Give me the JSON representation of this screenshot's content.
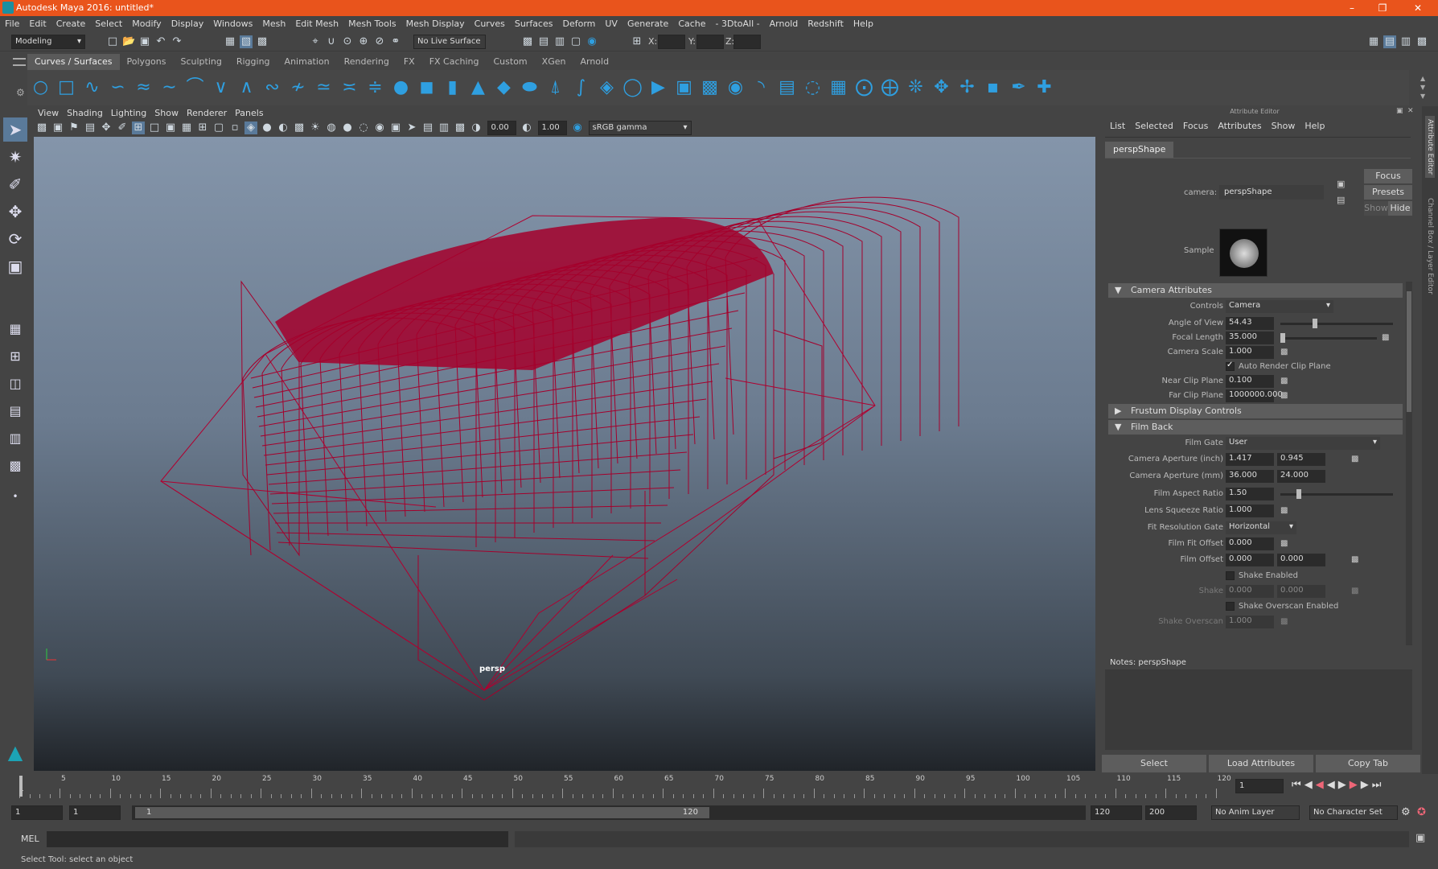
{
  "title": "Autodesk Maya 2016: untitled*",
  "menu": [
    "File",
    "Edit",
    "Create",
    "Select",
    "Modify",
    "Display",
    "Windows",
    "Mesh",
    "Edit Mesh",
    "Mesh Tools",
    "Mesh Display",
    "Curves",
    "Surfaces",
    "Deform",
    "UV",
    "Generate",
    "Cache",
    "- 3DtoAll -",
    "Arnold",
    "Redshift",
    "Help"
  ],
  "status": {
    "mode": "Modeling",
    "live": "No Live Surface",
    "x_label": "X:",
    "y_label": "Y:",
    "z_label": "Z:"
  },
  "shelf_tabs": [
    "Curves / Surfaces",
    "Polygons",
    "Sculpting",
    "Rigging",
    "Animation",
    "Rendering",
    "FX",
    "FX Caching",
    "Custom",
    "XGen",
    "Arnold"
  ],
  "viewport": {
    "menu": [
      "View",
      "Shading",
      "Lighting",
      "Show",
      "Renderer",
      "Panels"
    ],
    "exposure": "0.00",
    "gamma": "1.00",
    "colorspace": "sRGB gamma",
    "camera_label": "persp"
  },
  "attr": {
    "panel_title": "Attribute Editor",
    "menu": [
      "List",
      "Selected",
      "Focus",
      "Attributes",
      "Show",
      "Help"
    ],
    "tab": "perspShape",
    "camera_label": "camera:",
    "camera_value": "perspShape",
    "focus": "Focus",
    "presets": "Presets",
    "show": "Show",
    "hide": "Hide",
    "sample": "Sample",
    "sections": {
      "camera": "Camera Attributes",
      "frustum": "Frustum Display Controls",
      "filmback": "Film Back"
    },
    "controls_label": "Controls",
    "controls_value": "Camera",
    "angle_label": "Angle of View",
    "angle": "54.43",
    "focal_label": "Focal Length",
    "focal": "35.000",
    "scale_label": "Camera Scale",
    "scale": "1.000",
    "auto_clip": "Auto Render Clip Plane",
    "near_label": "Near Clip Plane",
    "near": "0.100",
    "far_label": "Far Clip Plane",
    "far": "1000000.000",
    "gate_label": "Film Gate",
    "gate": "User",
    "ap_in_label": "Camera Aperture (inch)",
    "ap_in1": "1.417",
    "ap_in2": "0.945",
    "ap_mm_label": "Camera Aperture (mm)",
    "ap_mm1": "36.000",
    "ap_mm2": "24.000",
    "aspect_label": "Film Aspect Ratio",
    "aspect": "1.50",
    "squeeze_label": "Lens Squeeze Ratio",
    "squeeze": "1.000",
    "fitgate_label": "Fit Resolution Gate",
    "fitgate": "Horizontal",
    "fitoff_label": "Film Fit Offset",
    "fitoff": "0.000",
    "filmoff_label": "Film Offset",
    "filmoff1": "0.000",
    "filmoff2": "0.000",
    "shake_en": "Shake Enabled",
    "shake_label": "Shake",
    "shake1": "0.000",
    "shake2": "0.000",
    "shake_ov_en": "Shake Overscan Enabled",
    "shake_ov_label": "Shake Overscan",
    "shake_ov": "1.000",
    "notes": "Notes:  perspShape",
    "btn_select": "Select",
    "btn_load": "Load Attributes",
    "btn_copy": "Copy Tab",
    "side_tabs": [
      "Attribute Editor",
      "Channel Box / Layer Editor"
    ]
  },
  "timeline": {
    "ticks": [
      "5",
      "10",
      "15",
      "20",
      "25",
      "30",
      "35",
      "40",
      "45",
      "50",
      "55",
      "60",
      "65",
      "70",
      "75",
      "80",
      "85",
      "90",
      "95",
      "100",
      "105",
      "110",
      "115",
      "120"
    ],
    "start_mark": "1",
    "current": "1"
  },
  "range": {
    "start": "1",
    "inner_start": "1",
    "slider_start": "1",
    "slider_end": "120",
    "end1": "120",
    "end2": "200",
    "anim_layer": "No Anim Layer",
    "char_set": "No Character Set"
  },
  "cmd": {
    "label": "MEL"
  },
  "help": "Select Tool: select an object"
}
